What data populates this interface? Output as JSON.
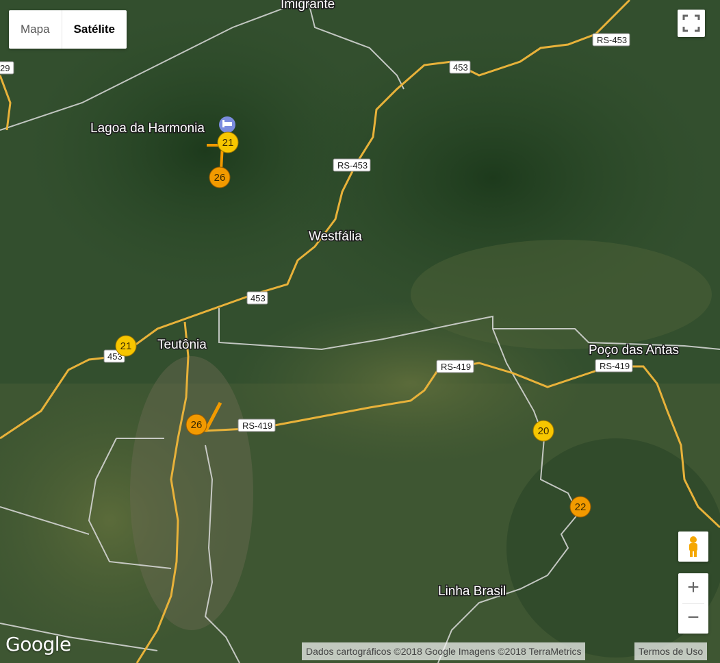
{
  "map_type": {
    "map_label": "Mapa",
    "satellite_label": "Satélite",
    "selected": "Satélite"
  },
  "places": {
    "imigrante": "Imigrante",
    "lagoa": "Lagoa da Harmonia",
    "westfalia": "Westfália",
    "teutonia": "Teutônia",
    "poco": "Poço das Antas",
    "linha": "Linha Brasil"
  },
  "shields": {
    "rs453_top": "RS-453",
    "s453_a": "453",
    "rs453_mid": "RS-453",
    "s453_b": "453",
    "s453_c": "453",
    "rs419_a": "RS-419",
    "rs419_b": "RS-419",
    "rs419_c": "RS-419",
    "edge": "29"
  },
  "markers": {
    "m21_top": "21",
    "m26_top": "26",
    "m21_left": "21",
    "m26_center": "26",
    "m20": "20",
    "m22": "22"
  },
  "colors": {
    "marker_yellow": "#f7c600",
    "marker_orange": "#f29a00",
    "road": "#e8b23a"
  },
  "icons": {
    "hotel": "hotel-icon",
    "fullscreen": "fullscreen-icon",
    "pegman": "pegman-icon"
  },
  "zoom": {
    "in": "+",
    "out": "−"
  },
  "logo": "Google",
  "attribution": "Dados cartográficos ©2018 Google Imagens ©2018 TerraMetrics",
  "terms": "Termos de Uso"
}
